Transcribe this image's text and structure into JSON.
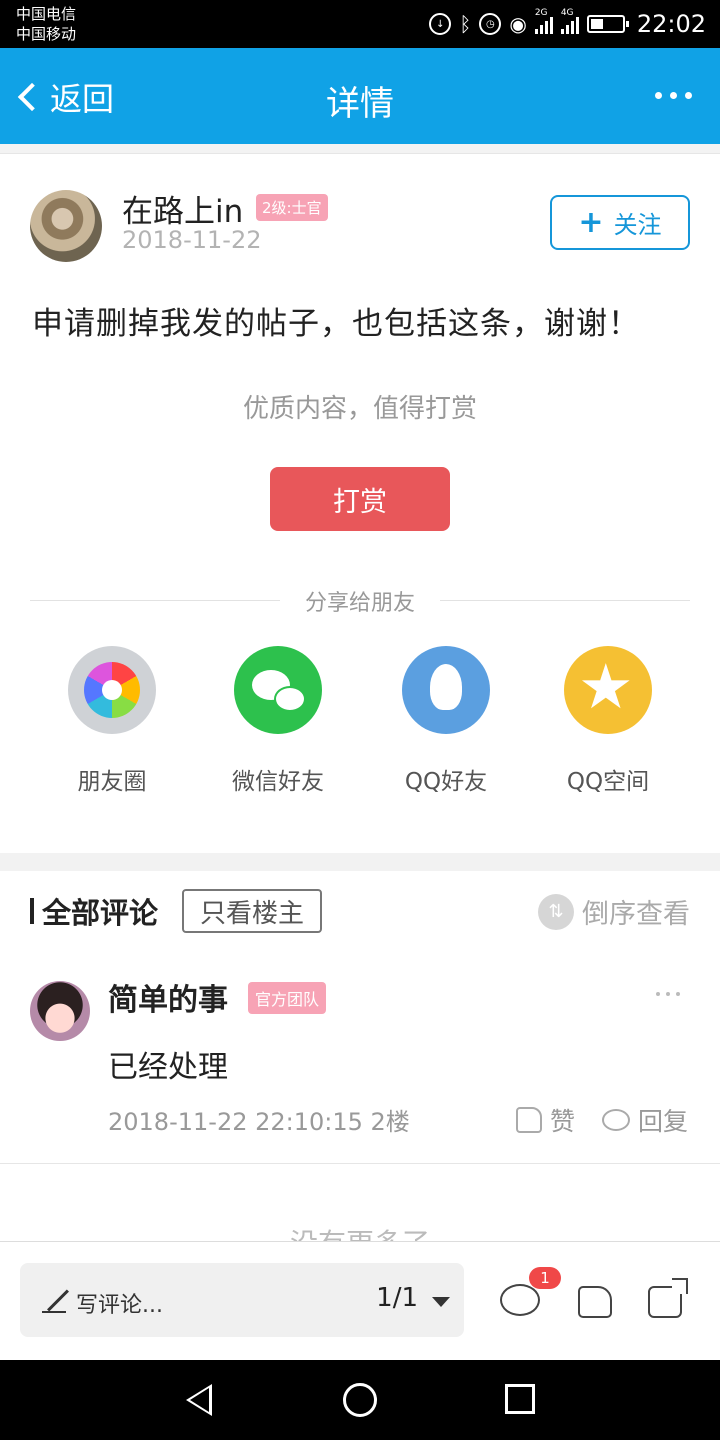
{
  "status_bar": {
    "carrier1": "中国电信",
    "carrier2": "中国移动",
    "time": "22:02",
    "net1": "2G",
    "net2": "4G"
  },
  "nav": {
    "back_label": "返回",
    "title": "详情"
  },
  "post": {
    "author": "在路上in",
    "level": "2级:士官",
    "date": "2018-11-22",
    "follow_label": "关注",
    "content": "申请删掉我发的帖子，也包括这条，谢谢！",
    "reward_hint": "优质内容，值得打赏",
    "reward_button": "打赏"
  },
  "share": {
    "title": "分享给朋友",
    "items": [
      {
        "label": "朋友圈",
        "icon": "moments-icon"
      },
      {
        "label": "微信好友",
        "icon": "wechat-icon"
      },
      {
        "label": "QQ好友",
        "icon": "qq-icon"
      },
      {
        "label": "QQ空间",
        "icon": "qzone-icon"
      }
    ]
  },
  "comments": {
    "header": "全部评论",
    "owner_only": "只看楼主",
    "sort_reverse": "倒序查看",
    "items": [
      {
        "name": "简单的事",
        "badge": "官方团队",
        "text": "已经处理",
        "meta": "2018-11-22 22:10:15  2楼",
        "like_label": "赞",
        "reply_label": "回复"
      }
    ],
    "end_text": "没有更多了"
  },
  "bottom_bar": {
    "write_placeholder": "写评论...",
    "page": "1/1",
    "comment_count": "1"
  },
  "colors": {
    "nav_blue": "#10a2e6",
    "reward_red": "#e8575a",
    "badge_pink": "#f7a3b5"
  }
}
